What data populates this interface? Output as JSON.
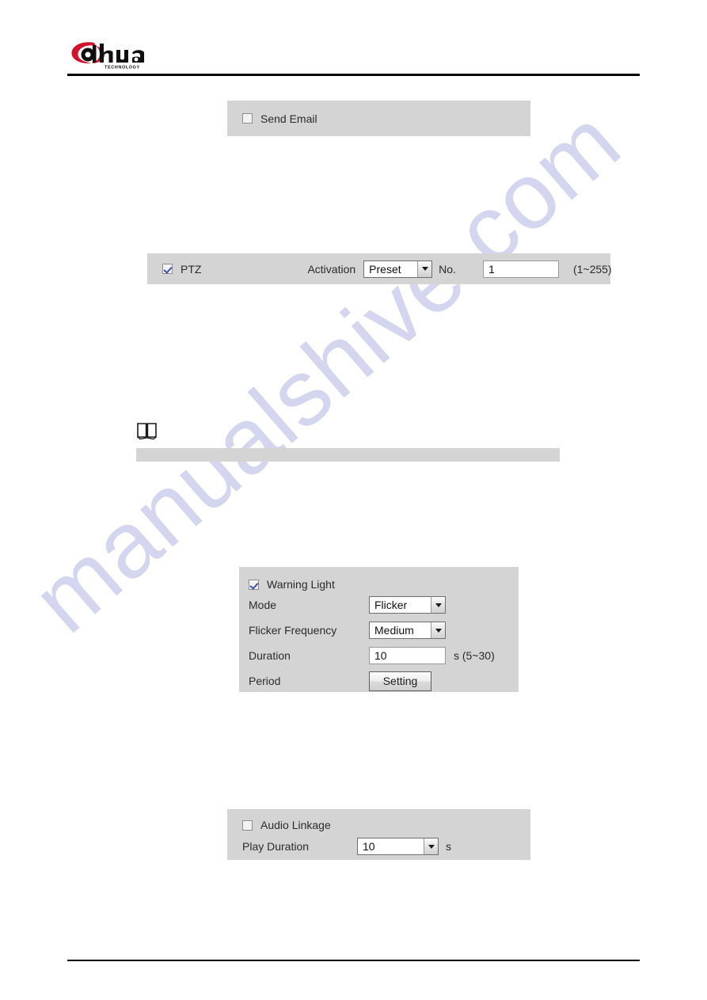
{
  "header": {
    "brand_name": "alhua",
    "brand_sub": "TECHNOLOGY",
    "logo_red": "#d3112b",
    "logo_black": "#0f0f0f"
  },
  "watermark": {
    "text": "manualshive.com",
    "color": "#b9bde4"
  },
  "panels": {
    "send_email": {
      "checkbox_label": "Send Email",
      "checked": false
    },
    "ptz": {
      "checkbox_label": "PTZ",
      "checked": true,
      "activation_label": "Activation",
      "activation_value": "Preset",
      "no_label": "No.",
      "no_value": "1",
      "range_hint": "(1~255)"
    },
    "warning_light": {
      "checkbox_label": "Warning Light",
      "checked": true,
      "mode_label": "Mode",
      "mode_value": "Flicker",
      "flicker_frequency_label": "Flicker Frequency",
      "flicker_frequency_value": "Medium",
      "duration_label": "Duration",
      "duration_value": "10",
      "duration_suffix": "s (5~30)",
      "period_label": "Period",
      "period_button": "Setting"
    },
    "audio_linkage": {
      "checkbox_label": "Audio Linkage",
      "checked": false,
      "play_duration_label": "Play Duration",
      "play_duration_value": "10",
      "play_duration_suffix": "s"
    }
  },
  "note": {
    "icon": "open-book-icon",
    "text": ""
  }
}
